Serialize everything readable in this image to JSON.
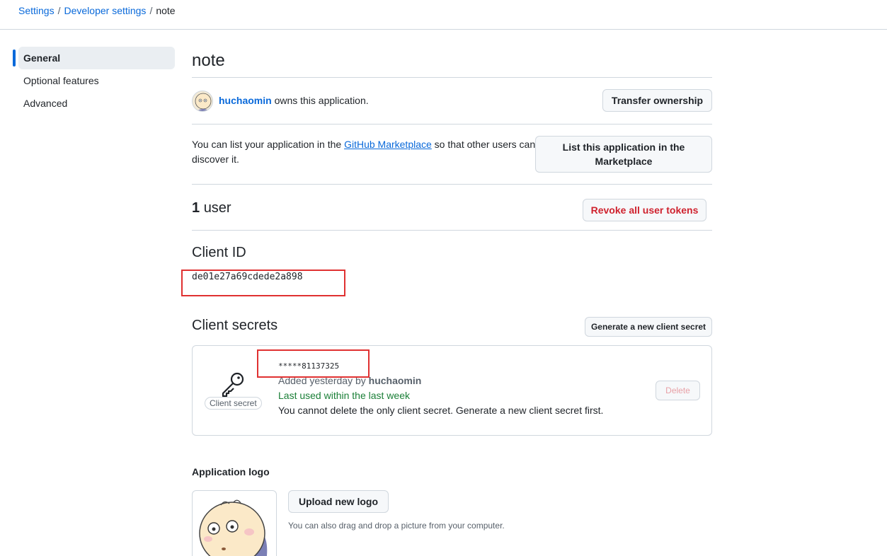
{
  "breadcrumb": {
    "settings": "Settings",
    "developer_settings": "Developer settings",
    "current": "note",
    "separator": "/"
  },
  "sidebar": {
    "items": [
      {
        "label": "General",
        "active": true
      },
      {
        "label": "Optional features",
        "active": false
      },
      {
        "label": "Advanced",
        "active": false
      }
    ]
  },
  "app": {
    "title": "note",
    "owner": {
      "username": "huchaomin",
      "suffix": "owns this application.",
      "transfer_button": "Transfer ownership"
    },
    "marketplace": {
      "text_before": "You can list your application in the ",
      "link": "GitHub Marketplace",
      "text_after": " so that other users can discover it.",
      "button": "List this application in the Marketplace"
    },
    "users": {
      "count": "1",
      "label": "user",
      "revoke_button": "Revoke all user tokens"
    },
    "client_id": {
      "heading": "Client ID",
      "value": "de01e27a69cdede2a898"
    },
    "client_secrets": {
      "heading": "Client secrets",
      "generate_button": "Generate a new client secret",
      "secret": {
        "badge": "Client secret",
        "masked_value": "*****81137325",
        "added_prefix": "Added yesterday by ",
        "added_by": "huchaomin",
        "last_used": "Last used within the last week",
        "note": "You cannot delete the only client secret. Generate a new client secret first.",
        "delete_button": "Delete"
      }
    },
    "logo": {
      "heading": "Application logo",
      "upload_button": "Upload new logo",
      "hint": "You can also drag and drop a picture from your computer."
    }
  },
  "colors": {
    "link": "#0969da",
    "danger": "#cf222e",
    "success": "#1a7f37",
    "border": "#d0d7de",
    "annotation": "#e03131"
  }
}
